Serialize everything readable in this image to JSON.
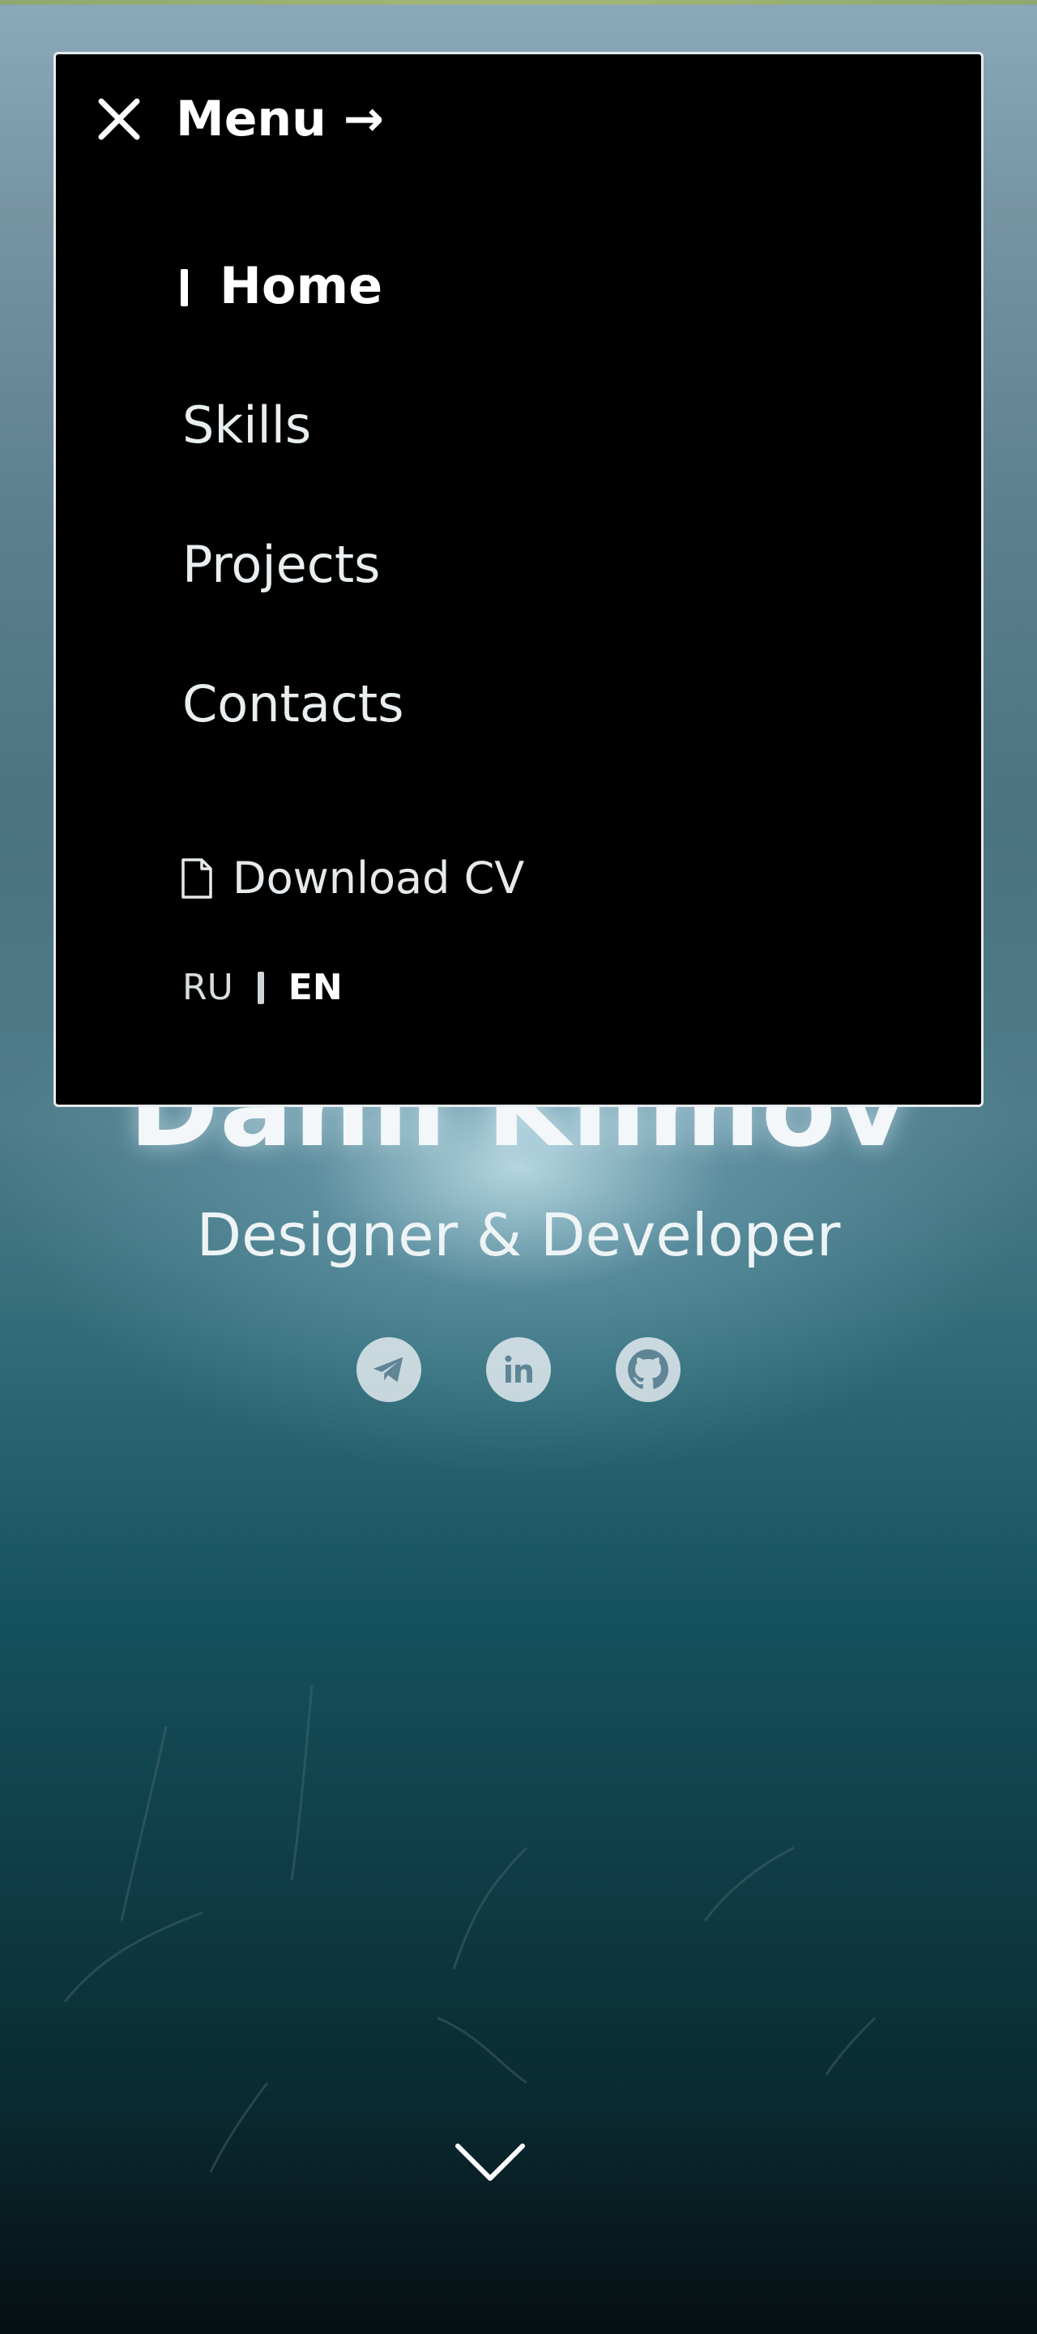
{
  "menu": {
    "title": "Menu →",
    "close_icon": "close-icon",
    "items": [
      {
        "label": "Home",
        "active": true
      },
      {
        "label": "Skills",
        "active": false
      },
      {
        "label": "Projects",
        "active": false
      },
      {
        "label": "Contacts",
        "active": false
      }
    ],
    "cv_label": "Download CV",
    "cv_icon": "document-icon",
    "languages": {
      "ru": "RU",
      "en": "EN",
      "selected": "EN"
    }
  },
  "hero": {
    "name": "Danil Klimov",
    "role": "Designer & Developer",
    "socials": [
      {
        "icon": "telegram-icon"
      },
      {
        "icon": "linkedin-icon"
      },
      {
        "icon": "github-icon"
      }
    ],
    "scroll_icon": "chevron-down-icon"
  },
  "colors": {
    "panel_bg": "#000000",
    "panel_border": "#e6eaec",
    "text": "#ffffff",
    "social_bg": "#e6eef2"
  }
}
